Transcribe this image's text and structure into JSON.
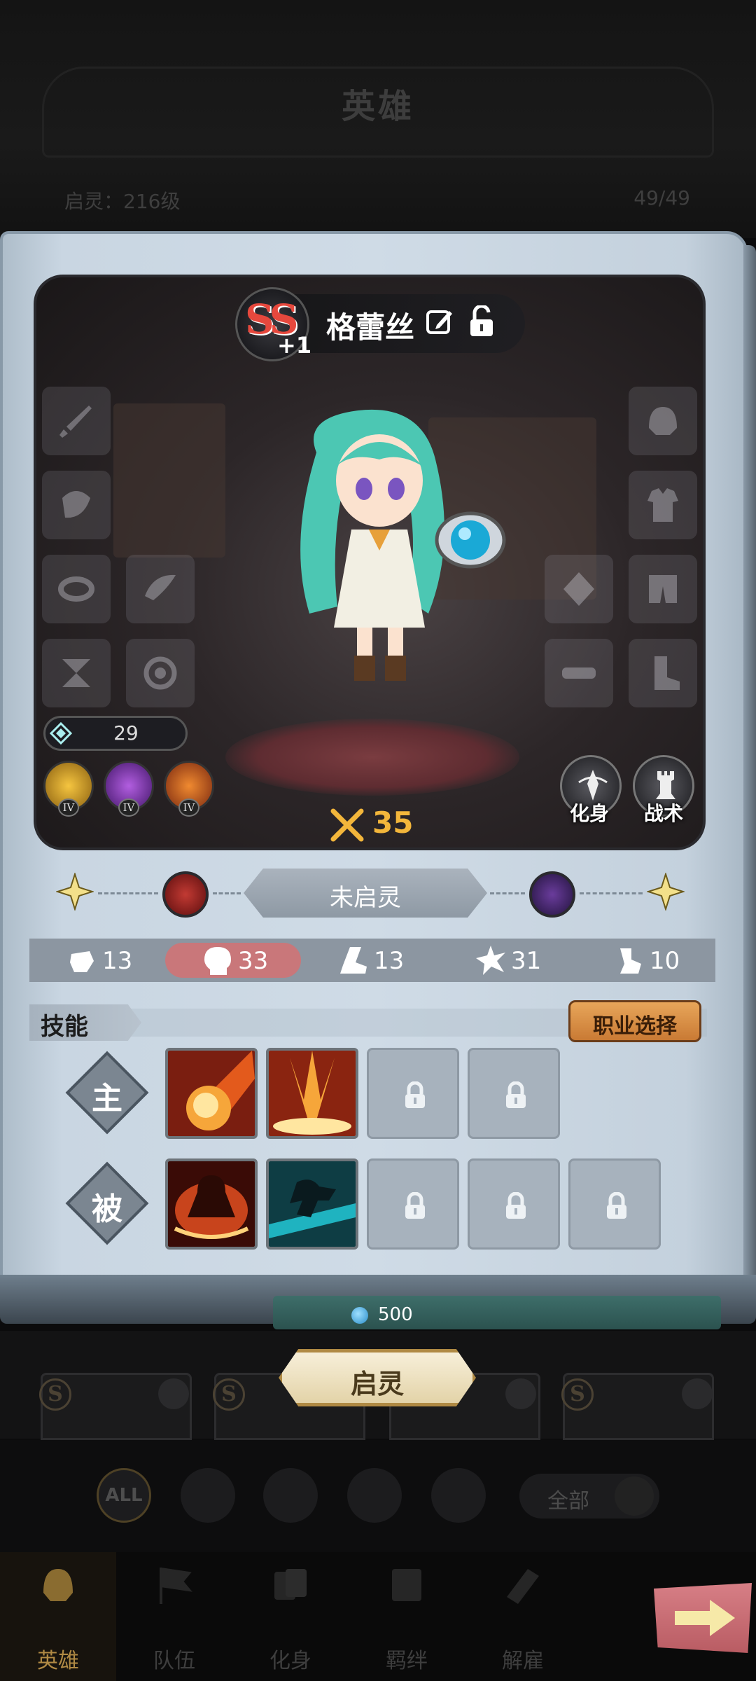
{
  "header": {
    "title": "英雄",
    "awaken_level": "启灵：216级",
    "hero_count": "49/49"
  },
  "hero": {
    "rank": "SS",
    "rank_plus": "+1",
    "name": "格蕾丝",
    "gem_count": "29",
    "power": "35",
    "aura_levels": [
      "IV",
      "IV",
      "IV"
    ],
    "buttons": {
      "avatar": "化身",
      "tactics": "战术"
    }
  },
  "awakening": {
    "status": "未启灵"
  },
  "stats": [
    {
      "icon": "fist-icon",
      "value": "13"
    },
    {
      "icon": "head-icon",
      "value": "33"
    },
    {
      "icon": "boot-icon",
      "value": "13"
    },
    {
      "icon": "burst-icon",
      "value": "31"
    },
    {
      "icon": "arm-icon",
      "value": "10"
    }
  ],
  "skills": {
    "title": "技能",
    "class_select": "职业选择",
    "active_label": "主",
    "passive_label": "被"
  },
  "cost": {
    "value": "500"
  },
  "actions": {
    "awaken": "启灵"
  },
  "filters": {
    "all": "ALL",
    "dropdown": "全部"
  },
  "nav": [
    {
      "label": "英雄",
      "active": true
    },
    {
      "label": "队伍",
      "active": false
    },
    {
      "label": "化身",
      "active": false
    },
    {
      "label": "羁绊",
      "active": false
    },
    {
      "label": "解雇",
      "active": false
    }
  ],
  "colors": {
    "accent_gold": "#f3b63b",
    "ss_red": "#e6483d",
    "active_stat": "#c9777a",
    "button_orange": "#d98c43"
  }
}
